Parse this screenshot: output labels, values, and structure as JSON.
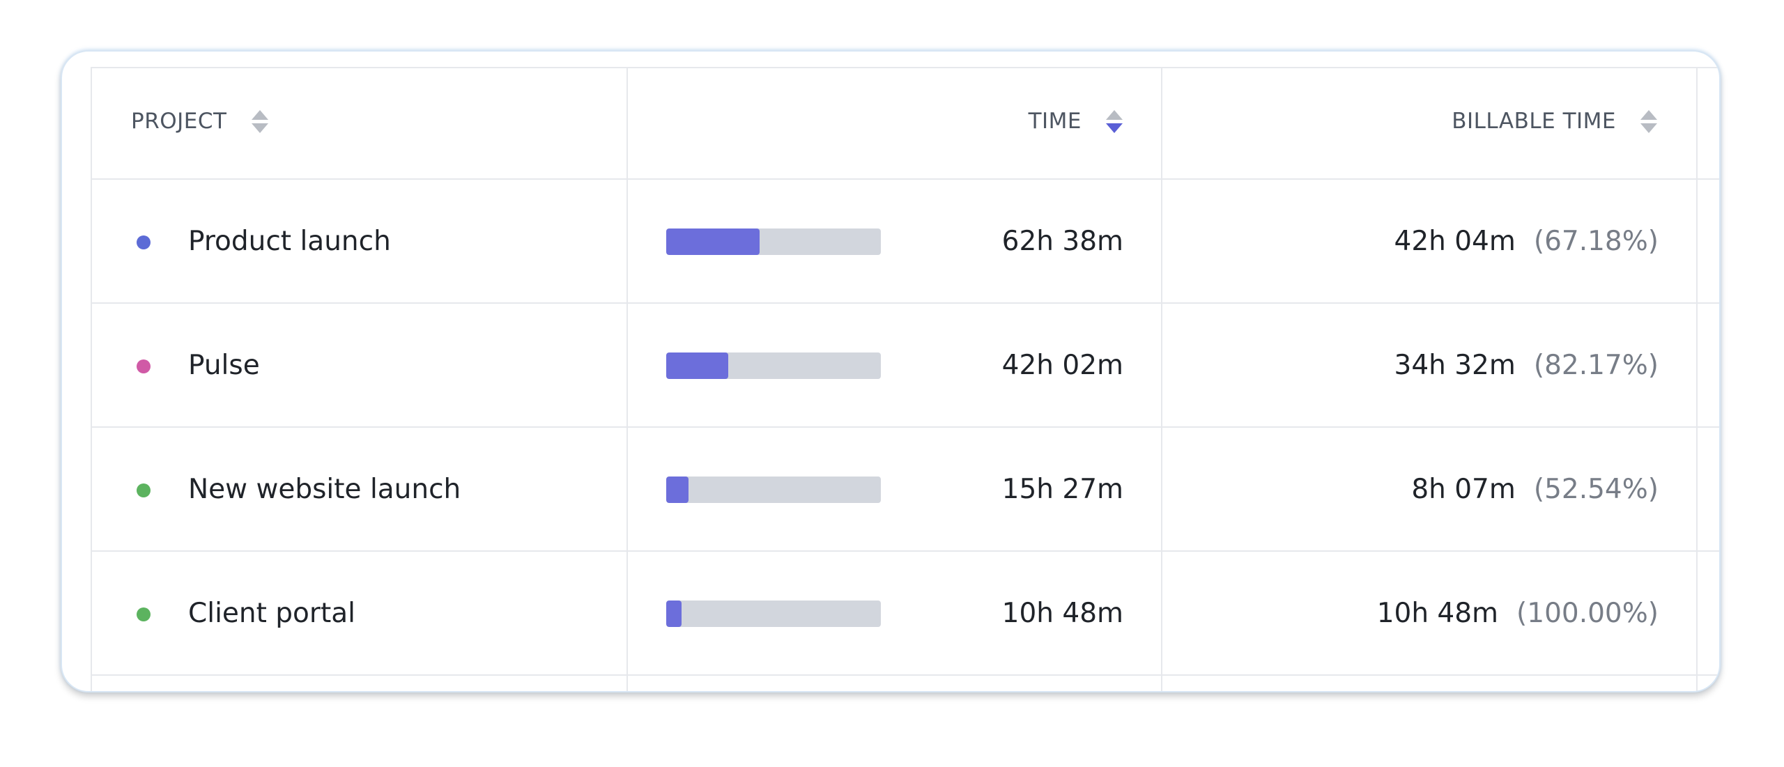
{
  "columns": {
    "project": "PROJECT",
    "time": "TIME",
    "billable": "BILLABLE TIME"
  },
  "rows": [
    {
      "name": "Product launch",
      "color": "#5c6bd6",
      "time": "62h 38m",
      "bar_fraction": 0.435,
      "billable": "42h 04m",
      "pct": "(67.18%)"
    },
    {
      "name": "Pulse",
      "color": "#d05aa6",
      "time": "42h 02m",
      "bar_fraction": 0.29,
      "billable": "34h 32m",
      "pct": "(82.17%)"
    },
    {
      "name": "New website launch",
      "color": "#5cb35f",
      "time": "15h 27m",
      "bar_fraction": 0.105,
      "billable": "8h 07m",
      "pct": "(52.54%)"
    },
    {
      "name": "Client portal",
      "color": "#5cb35f",
      "time": "10h 48m",
      "bar_fraction": 0.07,
      "billable": "10h 48m",
      "pct": "(100.00%)"
    }
  ]
}
